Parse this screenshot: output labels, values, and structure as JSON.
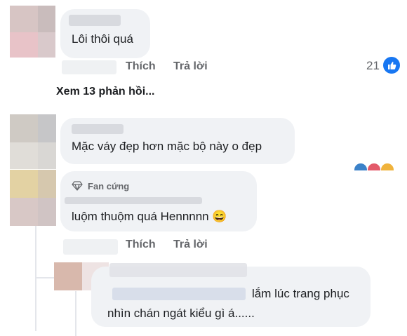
{
  "comments": [
    {
      "text": "Lôi thôi quá"
    },
    {
      "text": "Mặc váy đẹp hơn  mặc bộ này o đẹp"
    },
    {
      "badge": "Fan cứng",
      "text": "luộm thuộm quá Hennnnn 😄"
    },
    {
      "text_line1": "lắm lúc trang phục",
      "text_line2": "nhìn chán ngát kiểu gì á......"
    }
  ],
  "actions": {
    "like": "Thích",
    "reply": "Trả lời"
  },
  "reaction_count": "21",
  "view_replies": "Xem 13 phản hồi...",
  "icons": {
    "like": "thumbs-up-icon",
    "badge": "diamond-icon",
    "emoji": "grinning-face-emoji"
  },
  "colors": {
    "bubble": "#f0f2f5",
    "like_blue": "#1877f2",
    "muted": "#65676b"
  }
}
